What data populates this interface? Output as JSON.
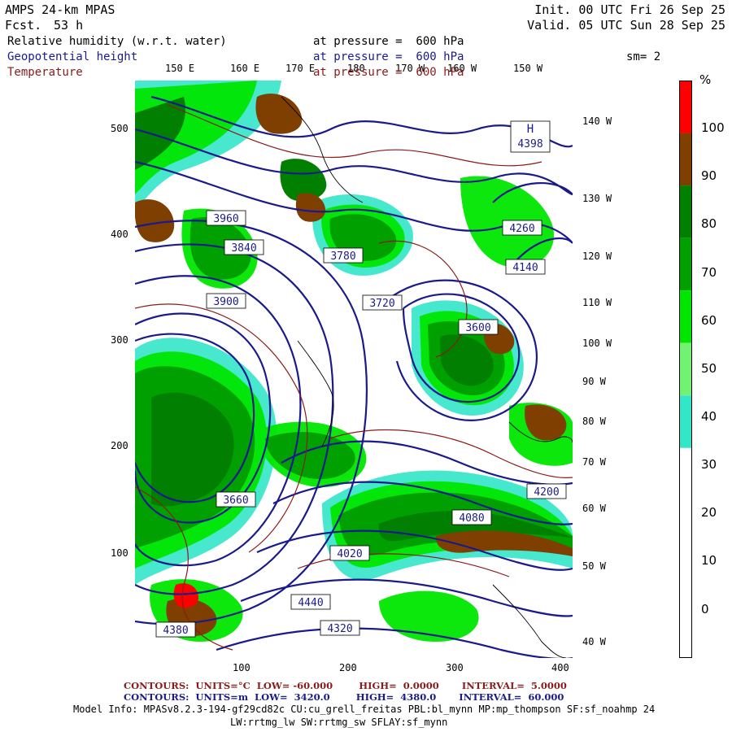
{
  "header": {
    "model": "AMPS 24-km MPAS",
    "fcst_label": "Fcst.",
    "fcst_value": "53 h",
    "init": "Init. 00 UTC Fri 26 Sep 25",
    "valid": "Valid. 05 UTC Sun 28 Sep 25",
    "smoothing": "sm= 2"
  },
  "variables": [
    {
      "name": "Relative humidity (w.r.t. water)",
      "level": "at pressure =  600 hPa",
      "color": "#000000"
    },
    {
      "name": "Geopotential height",
      "level": "at pressure =  600 hPa",
      "color": "#1a1a8c"
    },
    {
      "name": "Temperature",
      "level": "at pressure =  600 hPa",
      "color": "#8b1a1a"
    }
  ],
  "axes": {
    "y_ticks": [
      "500",
      "400",
      "300",
      "200",
      "100"
    ],
    "x_ticks": [
      "100",
      "200",
      "300",
      "400"
    ],
    "top_lon": [
      "150 E",
      "160 E",
      "170 E",
      "180",
      "170 W",
      "160 W",
      "150 W"
    ],
    "right_lon": [
      "140 W",
      "130 W",
      "120 W",
      "110 W",
      "100 W",
      "90 W",
      "80 W",
      "70 W",
      "60 W",
      "50 W",
      "40 W"
    ]
  },
  "legend": {
    "unit": "%",
    "labels": [
      "100",
      "90",
      "80",
      "70",
      "60",
      "50",
      "40",
      "30",
      "20",
      "10",
      "0"
    ],
    "colors": [
      "#ff0000",
      "#7f3f00",
      "#007f00",
      "#00a000",
      "#00e600",
      "#72f272",
      "#33e6c8",
      "#ffffff",
      "#ffffff",
      "#ffffff",
      "#ffffff"
    ]
  },
  "contour_labels": [
    "4398",
    "4260",
    "4140",
    "4080",
    "4020",
    "3960",
    "3900",
    "3840",
    "3780",
    "3720",
    "3660",
    "3600",
    "4200",
    "4320",
    "4380",
    "4440"
  ],
  "footer": {
    "temp_line": "CONTOURS:  UNITS=°C  LOW= -60.000        HIGH=  0.0000       INTERVAL=  5.0000",
    "height_line": "CONTOURS:  UNITS=m  LOW=  3420.0        HIGH=  4380.0       INTERVAL=  60.000",
    "model_info": "Model Info: MPASv8.2.3-194-gf29cd82c CU:cu_grell_freitas PBL:bl_mynn MP:mp_thompson SF:sf_noahmp 24",
    "model_info2": "LW:rrtmg_lw SW:rrtmg_sw SFLAY:sf_mynn"
  }
}
